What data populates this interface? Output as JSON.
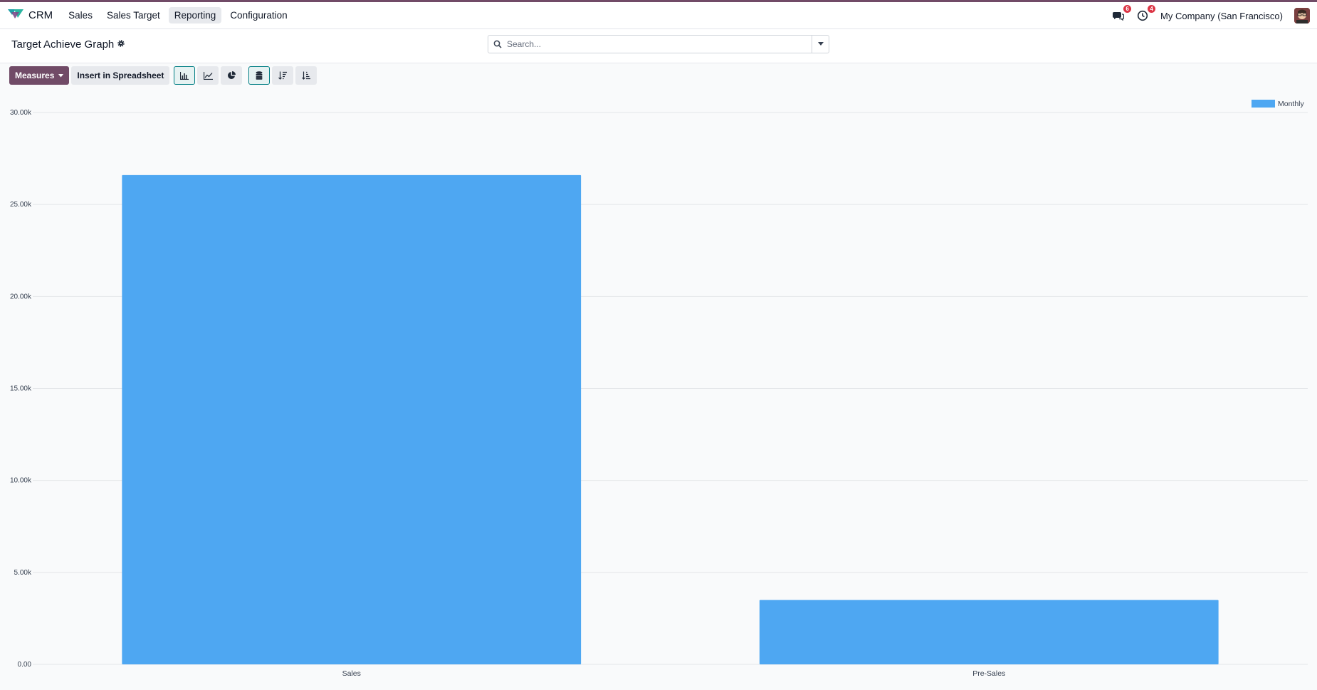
{
  "app": {
    "name": "CRM",
    "menu": [
      {
        "label": "Sales",
        "active": false
      },
      {
        "label": "Sales Target",
        "active": false
      },
      {
        "label": "Reporting",
        "active": true
      },
      {
        "label": "Configuration",
        "active": false
      }
    ],
    "messages_badge": "6",
    "activities_badge": "4",
    "company": "My Company (San Francisco)",
    "accent_color": "#714b67"
  },
  "page": {
    "title": "Target Achieve Graph"
  },
  "search": {
    "placeholder": "Search..."
  },
  "toolbar": {
    "measures_label": "Measures",
    "insert_label": "Insert in Spreadsheet",
    "view_buttons": [
      {
        "icon": "bar-chart-icon",
        "active": true
      },
      {
        "icon": "line-chart-icon",
        "active": false
      },
      {
        "icon": "pie-chart-icon",
        "active": false
      },
      {
        "icon": "stacked-icon",
        "active": true
      },
      {
        "icon": "sort-descending-icon",
        "active": false
      },
      {
        "icon": "sort-ascending-icon",
        "active": false
      }
    ]
  },
  "chart_data": {
    "type": "bar",
    "categories": [
      "Sales",
      "Pre-Sales"
    ],
    "series": [
      {
        "name": "Monthly",
        "values": [
          26600,
          3500
        ],
        "color": "#4ea7f2"
      }
    ],
    "ylim": [
      0,
      30000
    ],
    "yticks": [
      0,
      5000,
      10000,
      15000,
      20000,
      25000,
      30000
    ],
    "ytick_labels": [
      "0.00",
      "5.00k",
      "10.00k",
      "15.00k",
      "20.00k",
      "25.00k",
      "30.00k"
    ],
    "grid": true,
    "legend_position": "top-right",
    "title": "",
    "xlabel": "",
    "ylabel": ""
  }
}
